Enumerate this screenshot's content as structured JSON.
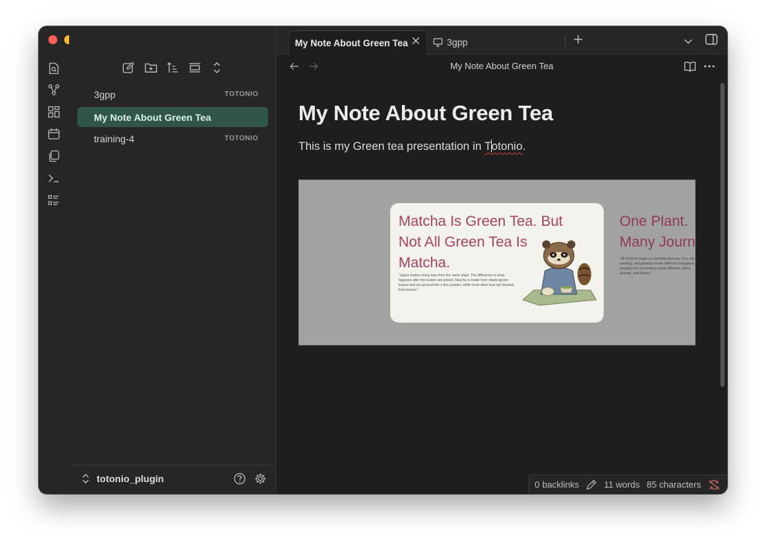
{
  "sidebar": {
    "files": [
      {
        "name": "3gpp",
        "tag": "TOTONIO"
      },
      {
        "name": "My Note About Green Tea",
        "tag": ""
      },
      {
        "name": "training-4",
        "tag": "TOTONIO"
      }
    ],
    "vault_name": "totonio_plugin"
  },
  "tabs": [
    {
      "label": "My Note About Green Tea",
      "active": true
    },
    {
      "label": "3gpp",
      "active": false
    }
  ],
  "navbar": {
    "title": "My Note About Green Tea"
  },
  "note": {
    "title": "My Note About Green Tea",
    "body_prefix": "This is my Green tea presentation in ",
    "body_word_start": "T",
    "body_word_rest": "otonio",
    "body_suffix": "."
  },
  "embed": {
    "slide1": {
      "title": "Matcha Is Green Tea. But Not All Green Tea Is Matcha.",
      "caption": "\"Japan makes many teas from the same plant. The difference is what happens after the leaves are picked. Matcha is made from shade-grown leaves that are ground into a fine powder, while most other teas are brewed from leaves.\""
    },
    "slide2": {
      "title_line1": "One Plant.",
      "title_line2": "Many Journ",
      "caption": "\"All of these begin as Camellia sinensis. Sun, steam, roasting, and grinding create different changes in growing and processing create different colors, aromas, and flavors.\""
    }
  },
  "status": {
    "backlinks": "0 backlinks",
    "words": "11 words",
    "characters": "85 characters"
  },
  "colors": {
    "accent_active_file": "#2f5649",
    "slide_title": "#a34366",
    "traffic_red": "#fe5f57",
    "traffic_yellow": "#febc2e",
    "traffic_green": "#28c840"
  }
}
